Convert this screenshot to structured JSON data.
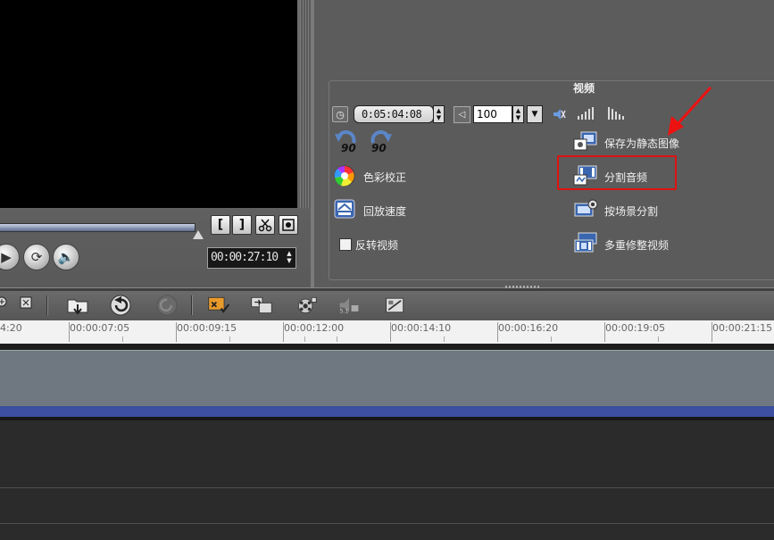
{
  "preview": {
    "timecode": "00:00:27:10",
    "trim_mark_in": "[",
    "trim_mark_out": "]"
  },
  "options": {
    "section_title": "视频",
    "duration_value": "0:05:04:08",
    "volume_value": "100",
    "left_actions": [
      {
        "label": "色彩校正",
        "icon": "color-wheel-icon"
      },
      {
        "label": "回放速度",
        "icon": "playback-speed-icon"
      }
    ],
    "reverse_label": "反转视频",
    "rotate_left_label": "90",
    "rotate_right_label": "90",
    "right_actions": [
      {
        "label": "保存为静态图像",
        "icon": "save-still-image-icon"
      },
      {
        "label": "分割音频",
        "icon": "split-audio-icon"
      },
      {
        "label": "按场景分割",
        "icon": "split-by-scene-icon"
      },
      {
        "label": "多重修整视频",
        "icon": "multi-trim-icon"
      }
    ],
    "highlight_color": "#e11111"
  },
  "timeline": {
    "ruler_labels": [
      "4:20",
      "00:00:07:05",
      "00:00:09:15",
      "00:00:12:00",
      "00:00:14:10",
      "00:00:16:20",
      "00:00:19:05",
      "00:00:21:15"
    ],
    "video_track_color": "#6f7780",
    "track_bar_color": "#3c4fa0"
  },
  "toolbar_icons": [
    "zoom-in-icon",
    "fit-icon",
    "insert-media-icon",
    "undo-icon",
    "redo-icon",
    "smart-render-icon",
    "batch-convert-icon",
    "record-capture-icon",
    "audio-mixer-icon",
    "auto-music-icon"
  ]
}
